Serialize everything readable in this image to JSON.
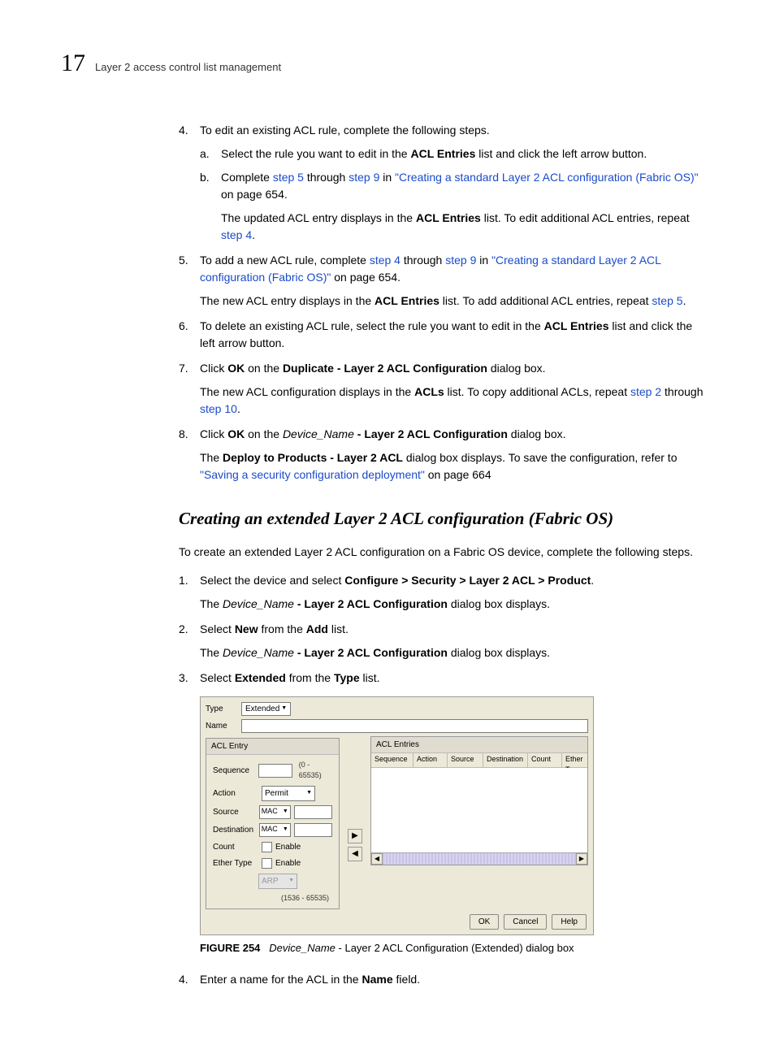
{
  "chapter_number": "17",
  "header_title": "Layer 2 access control list management",
  "step4": {
    "num": "4.",
    "text_1": "To edit an existing ACL rule, complete the following steps.",
    "a_letter": "a.",
    "a_text_1": "Select the rule you want to edit in the ",
    "a_bold": "ACL Entries",
    "a_text_2": " list and click the left arrow button.",
    "b_letter": "b.",
    "b_text_1": "Complete ",
    "b_link1": "step 5",
    "b_text_2": " through ",
    "b_link2": "step 9",
    "b_text_3": " in ",
    "b_link3": "\"Creating a standard Layer 2 ACL configuration (Fabric OS)\"",
    "b_text_4": " on page 654.",
    "follow_1": "The updated ACL entry displays in the ",
    "follow_bold": "ACL Entries",
    "follow_2": " list. To edit additional ACL entries, repeat ",
    "follow_link": "step 4",
    "follow_3": "."
  },
  "step5": {
    "num": "5.",
    "text_1": "To add a new ACL rule, complete ",
    "link1": "step 4",
    "text_2": " through ",
    "link2": "step 9",
    "text_3": " in ",
    "link3": "\"Creating a standard Layer 2 ACL configuration (Fabric OS)\"",
    "text_4": " on page 654.",
    "follow_1": "The new ACL entry displays in the ",
    "follow_bold": "ACL Entries",
    "follow_2": " list. To add additional ACL entries, repeat ",
    "follow_link": "step 5",
    "follow_3": "."
  },
  "step6": {
    "num": "6.",
    "text_1": "To delete an existing ACL rule, select the rule you want to edit in the ",
    "bold": "ACL Entries",
    "text_2": " list and click the left arrow button."
  },
  "step7": {
    "num": "7.",
    "text_1": "Click ",
    "bold1": "OK",
    "text_2": " on the ",
    "bold2": "Duplicate - Layer 2 ACL Configuration",
    "text_3": " dialog box.",
    "follow_1": "The new ACL configuration displays in the ",
    "follow_bold": "ACLs",
    "follow_2": " list. To copy additional ACLs, repeat ",
    "follow_link1": "step 2",
    "follow_3": " through ",
    "follow_link2": "step 10",
    "follow_4": "."
  },
  "step8": {
    "num": "8.",
    "text_1": "Click ",
    "bold1": "OK",
    "text_2": " on the ",
    "italic": "Device_Name",
    "bold2": " - Layer 2 ACL Configuration",
    "text_3": " dialog box.",
    "follow_1": "The ",
    "follow_bold": "Deploy to Products - Layer 2 ACL",
    "follow_2": " dialog box displays. To save the configuration, refer to ",
    "follow_link": "\"Saving a security configuration deployment\"",
    "follow_3": " on page 664"
  },
  "section_heading": "Creating an extended Layer 2 ACL configuration (Fabric OS)",
  "intro": "To create an extended Layer 2 ACL configuration on a Fabric OS device, complete the following steps.",
  "ext1": {
    "num": "1.",
    "text_1": "Select the device and select ",
    "bold": "Configure > Security > Layer 2 ACL > Product",
    "text_2": ".",
    "follow_1": "The ",
    "follow_italic": "Device_Name",
    "follow_bold": " - Layer 2 ACL Configuration",
    "follow_2": " dialog box displays."
  },
  "ext2": {
    "num": "2.",
    "text_1": "Select ",
    "bold1": "New",
    "text_2": " from the ",
    "bold2": "Add",
    "text_3": " list.",
    "follow_1": "The ",
    "follow_italic": "Device_Name",
    "follow_bold": " - Layer 2 ACL Configuration",
    "follow_2": " dialog box displays."
  },
  "ext3": {
    "num": "3.",
    "text_1": "Select ",
    "bold1": "Extended",
    "text_2": " from the ",
    "bold2": "Type",
    "text_3": " list."
  },
  "dialog": {
    "type_label": "Type",
    "type_value": "Extended",
    "name_label": "Name",
    "acl_entry_header": "ACL Entry",
    "sequence_label": "Sequence",
    "sequence_range": "(0 - 65535)",
    "action_label": "Action",
    "action_value": "Permit",
    "source_label": "Source",
    "mac_value": "MAC",
    "destination_label": "Destination",
    "count_label": "Count",
    "enable_label": "Enable",
    "ethertype_label": "Ether Type",
    "arp_value": "ARP",
    "ether_range": "(1536 - 65535)",
    "acl_entries_header": "ACL Entries",
    "col_sequence": "Sequence",
    "col_action": "Action",
    "col_source": "Source",
    "col_destination": "Destination",
    "col_count": "Count",
    "col_ethertype": "Ether Typ",
    "btn_ok": "OK",
    "btn_cancel": "Cancel",
    "btn_help": "Help"
  },
  "figure_caption": {
    "label": "FIGURE 254",
    "italic": "Device_Name",
    "rest": " - Layer 2 ACL Configuration (Extended) dialog box"
  },
  "ext4": {
    "num": "4.",
    "text_1": "Enter a name for the ACL in the ",
    "bold": "Name",
    "text_2": " field."
  }
}
